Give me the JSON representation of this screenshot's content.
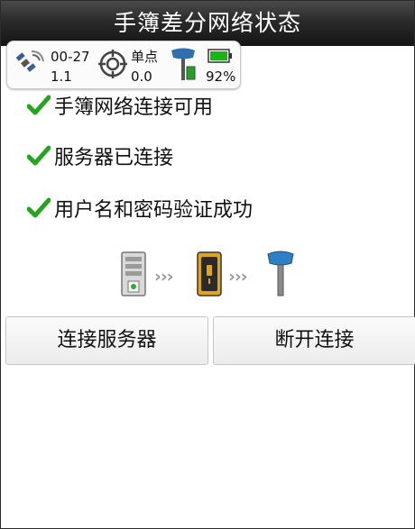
{
  "header": {
    "title": "手簿差分网络状态"
  },
  "status": {
    "satellites": "00-27",
    "pdop": "1.1",
    "solution": "单点",
    "age": "0.0",
    "battery": "92%"
  },
  "checks": [
    {
      "label": "手簿网络连接可用"
    },
    {
      "label": "服务器已连接"
    },
    {
      "label": "用户名和密码验证成功"
    }
  ],
  "flow": {
    "separator": "›››"
  },
  "buttons": {
    "connect": "连接服务器",
    "disconnect": "断开连接"
  },
  "colors": {
    "check": "#22a61d",
    "titlebar": "#222222",
    "battery": "#19b515"
  }
}
